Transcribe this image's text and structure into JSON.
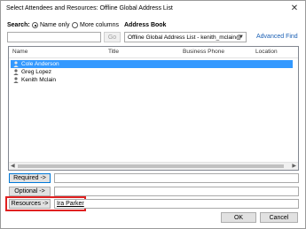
{
  "dialog": {
    "title": "Select Attendees and Resources: Offline Global Address List"
  },
  "search": {
    "label": "Search:",
    "option_name_only": "Name only",
    "option_more_columns": "More columns",
    "go_label": "Go",
    "name_only_selected": true
  },
  "address_book": {
    "label": "Address Book",
    "selected": "Offline Global Address List - kenith_mclain@",
    "advanced_find": "Advanced Find"
  },
  "list": {
    "columns": [
      "Name",
      "Title",
      "Business Phone",
      "Location"
    ],
    "rows": [
      {
        "name": "Cole Anderson",
        "selected": true
      },
      {
        "name": "Greg Lopez",
        "selected": false
      },
      {
        "name": "Kenith Mclain",
        "selected": false
      }
    ]
  },
  "recipients": {
    "required_label": "Required ->",
    "optional_label": "Optional ->",
    "resources_label": "Resources ->",
    "resources_value": "Ira Parker"
  },
  "footer": {
    "ok_label": "OK",
    "cancel_label": "Cancel"
  },
  "colors": {
    "selection": "#3399ff",
    "highlight": "#e02020",
    "link": "#1a5fb4"
  }
}
